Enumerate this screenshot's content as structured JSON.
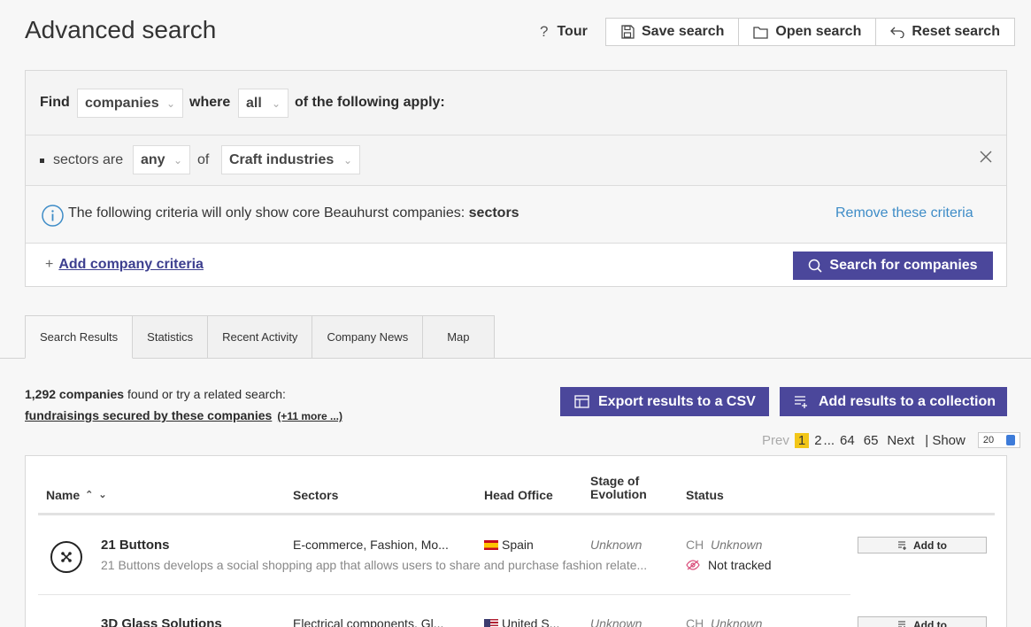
{
  "header": {
    "title": "Advanced search",
    "tour_label": "Tour",
    "save_label": "Save search",
    "open_label": "Open search",
    "reset_label": "Reset search"
  },
  "criteria": {
    "find_label": "Find",
    "find_value": "companies",
    "where_label": "where",
    "where_value": "all",
    "apply_label": "of the following apply:",
    "sector_prefix": "sectors are",
    "sector_mode": "any",
    "of_label": "of",
    "sector_value": "Craft industries",
    "info_text": "The following criteria will only show core Beauhurst companies: ",
    "info_bold": "sectors",
    "remove_label": "Remove these criteria",
    "add_label": "Add company criteria",
    "search_label": "Search for companies"
  },
  "tabs": [
    "Search Results",
    "Statistics",
    "Recent Activity",
    "Company News",
    "Map"
  ],
  "results": {
    "count": "1,292 companies",
    "count_suffix": " found or try a related search:",
    "related_link": "fundraisings secured by these companies",
    "more_link": "(+11 more ...)",
    "export_label": "Export results to a CSV",
    "collection_label": "Add results to a collection"
  },
  "pager": {
    "prev": "Prev",
    "current": "1",
    "p2": "2",
    "ellipsis": "...",
    "p64": "64",
    "p65": "65",
    "next": "Next",
    "show_label": "| Show",
    "show_value": "20"
  },
  "table": {
    "col_name": "Name",
    "col_sectors": "Sectors",
    "col_office": "Head Office",
    "col_stage": "Stage of Evolution",
    "col_status": "Status",
    "rows": [
      {
        "name": "21 Buttons",
        "description": "21 Buttons develops a social shopping app that allows users to share and purchase fashion relate...",
        "sectors": "E-commerce, Fashion, Mo...",
        "office": "Spain",
        "stage": "Unknown",
        "status_prefix": "CH",
        "status": "Unknown",
        "tracking": "Not tracked",
        "add_label": "Add to"
      },
      {
        "name": "3D Glass Solutions",
        "description": "",
        "sectors": "Electrical components, Gl...",
        "office": "United S...",
        "stage": "Unknown",
        "status_prefix": "CH",
        "status": "Unknown",
        "tracking": "",
        "add_label": "Add to"
      }
    ]
  },
  "colors": {
    "primary": "#4b479b",
    "link": "#3e8cc7",
    "highlight": "#f2c618"
  }
}
